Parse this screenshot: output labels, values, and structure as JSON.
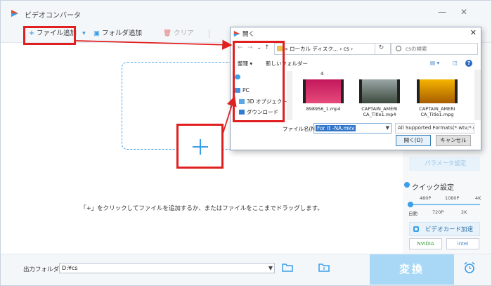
{
  "app": {
    "title": "ビデオコンバータ",
    "minimize": "—",
    "close": "✕"
  },
  "toolbar": {
    "add_file": "ファイル追加",
    "add_folder": "フォルダ追加",
    "clear": "クリア"
  },
  "workarea": {
    "hint": "「+」をクリックしてファイルを追加するか、またはファイルをここまでドラッグします。"
  },
  "rightpanel": {
    "params": "パラメータ設定",
    "quick": "クイック設定",
    "res_top": [
      "480P",
      "1080P",
      "4K"
    ],
    "res_bottom": [
      "自動",
      "720P",
      "2K"
    ],
    "gpu": "ビデオカード加速",
    "nvidia": "NVIDIA",
    "intel": "intel"
  },
  "bottom": {
    "output_label": "出力フォルダ：",
    "output_path": "D:¥cs",
    "convert": "変換"
  },
  "dialog": {
    "title": "開く",
    "path": "« ローカル ディスク... › cs ›",
    "search_placeholder": "csの検索",
    "organize": "整理 ▾",
    "new_folder": "新しいフォルダー",
    "count": "4",
    "nav": [
      "PC",
      "3D オブジェクト",
      "ダウンロード"
    ],
    "files": [
      {
        "name": "898956_1.mp4"
      },
      {
        "name": "CAPTAIN_AMERICA_Title1.mp4"
      },
      {
        "name": "CAPTAIN_AMERICA_Title1.mpg"
      }
    ],
    "file_names": [
      "898956_1.mp4",
      "CAPTAIN_AMERI\nCA_Title1.mp4",
      "CAPTAIN_AMERI\nCA_Title1.mpg"
    ],
    "filename_label": "ファイル名(N):",
    "filename_value": "For It -NA.mkv",
    "filter": "All Supported Formats(*.wtv;*.c",
    "open_btn": "開く(O)",
    "cancel_btn": "キャンセル"
  },
  "colors": {
    "accent": "#3a9ee8",
    "annotation": "#e02020",
    "convert": "#a9d8f6"
  }
}
